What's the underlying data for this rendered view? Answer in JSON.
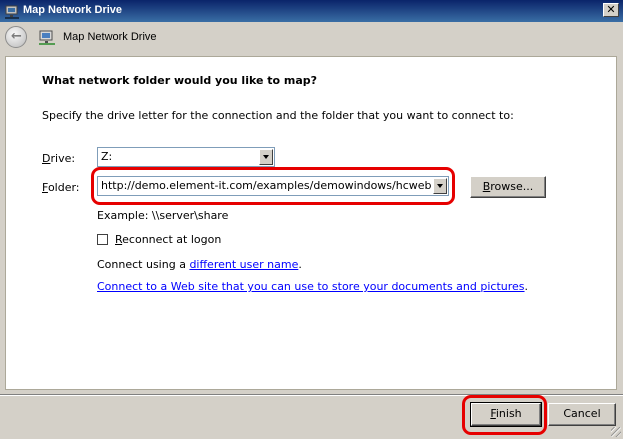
{
  "window": {
    "title": "Map Network Drive",
    "close_label": "✕"
  },
  "header": {
    "title": "Map Network Drive"
  },
  "content": {
    "heading": "What network folder would you like to map?",
    "instruction": "Specify the drive letter for the connection and the folder that you want to connect to:",
    "drive": {
      "label_mnemonic": "D",
      "label_rest": "rive:",
      "value": "Z:"
    },
    "folder": {
      "label_mnemonic": "F",
      "label_rest": "older:",
      "value": "http://demo.element-it.com/examples/demowindows/hcweb"
    },
    "browse": {
      "label_mnemonic": "B",
      "label_rest": "rowse..."
    },
    "example": "Example: \\\\server\\share",
    "reconnect": {
      "label_mnemonic": "R",
      "label_rest": "econnect at logon",
      "checked": false
    },
    "connect_using": {
      "prefix": "Connect using a ",
      "link": "different user name",
      "suffix": "."
    },
    "web_link": {
      "link": "Connect to a Web site that you can use to store your documents and pictures",
      "suffix": "."
    }
  },
  "footer": {
    "finish": {
      "label_mnemonic": "F",
      "label_rest": "inish"
    },
    "cancel": "Cancel"
  },
  "colors": {
    "highlight": "#e60000",
    "link": "#0000ff"
  }
}
